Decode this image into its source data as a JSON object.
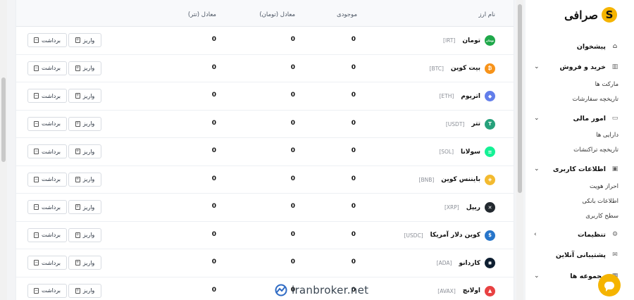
{
  "table": {
    "headers": {
      "name": "نام ارز",
      "balance": "موجودی",
      "toman": "معادل (تومان)",
      "usdt": "معادل (تتر)"
    },
    "deposit_label": "واریز",
    "withdraw_label": "برداشت",
    "rows": [
      {
        "name": "تومان",
        "symbol": "[IRT]",
        "balance": "0",
        "toman": "0",
        "usdt": "0",
        "icon": "toman-icon",
        "color": "#1fa84a",
        "glyph": "تومان"
      },
      {
        "name": "بیت کوین",
        "symbol": "[BTC]",
        "balance": "0",
        "toman": "0",
        "usdt": "0",
        "icon": "bitcoin-icon",
        "color": "#f7931a",
        "glyph": "₿"
      },
      {
        "name": "اتریوم",
        "symbol": "[ETH]",
        "balance": "0",
        "toman": "0",
        "usdt": "0",
        "icon": "ethereum-icon",
        "color": "#627eea",
        "glyph": "◆"
      },
      {
        "name": "تتر",
        "symbol": "[USDT]",
        "balance": "0",
        "toman": "0",
        "usdt": "0",
        "icon": "tether-icon",
        "color": "#26a17b",
        "glyph": "T"
      },
      {
        "name": "سولانا",
        "symbol": "[SOL]",
        "balance": "0",
        "toman": "0",
        "usdt": "0",
        "icon": "solana-icon",
        "color": "#14f195",
        "glyph": "≡"
      },
      {
        "name": "بایننس کوین",
        "symbol": "[BNB]",
        "balance": "0",
        "toman": "0",
        "usdt": "0",
        "icon": "bnb-icon",
        "color": "#f3ba2f",
        "glyph": "◈"
      },
      {
        "name": "ریپل",
        "symbol": "[XRP]",
        "balance": "0",
        "toman": "0",
        "usdt": "0",
        "icon": "xrp-icon",
        "color": "#23292f",
        "glyph": "✕"
      },
      {
        "name": "کوین دلار آمریکا",
        "symbol": "[USDC]",
        "balance": "0",
        "toman": "0",
        "usdt": "0",
        "icon": "usdc-icon",
        "color": "#2775ca",
        "glyph": "$"
      },
      {
        "name": "کاردانو",
        "symbol": "[ADA]",
        "balance": "0",
        "toman": "0",
        "usdt": "0",
        "icon": "cardano-icon",
        "color": "#0d1e30",
        "glyph": "✺"
      },
      {
        "name": "اولانچ",
        "symbol": "[AVAX]",
        "balance": "0",
        "toman": "0",
        "usdt": "0",
        "icon": "avalanche-icon",
        "color": "#e84142",
        "glyph": "▲"
      }
    ]
  },
  "sidebar": {
    "brand": "صرافی",
    "dashboard": "پیشخوان",
    "trade": "خرید و فروش",
    "trade_sub": [
      "مارکت ها",
      "تاریخچه سفارشات"
    ],
    "finance": "امور مالی",
    "finance_sub": [
      "دارایی ها",
      "تاریخچه تراکنشات"
    ],
    "user_info": "اطلاعات کاربری",
    "user_sub": [
      "احراز هویت",
      "اطلاعات بانکی",
      "سطح کاربری"
    ],
    "settings": "تنظیمات",
    "support": "پشتیبانی آنلاین",
    "collections": "مجموعه ها"
  },
  "watermark": "iranbroker.net"
}
